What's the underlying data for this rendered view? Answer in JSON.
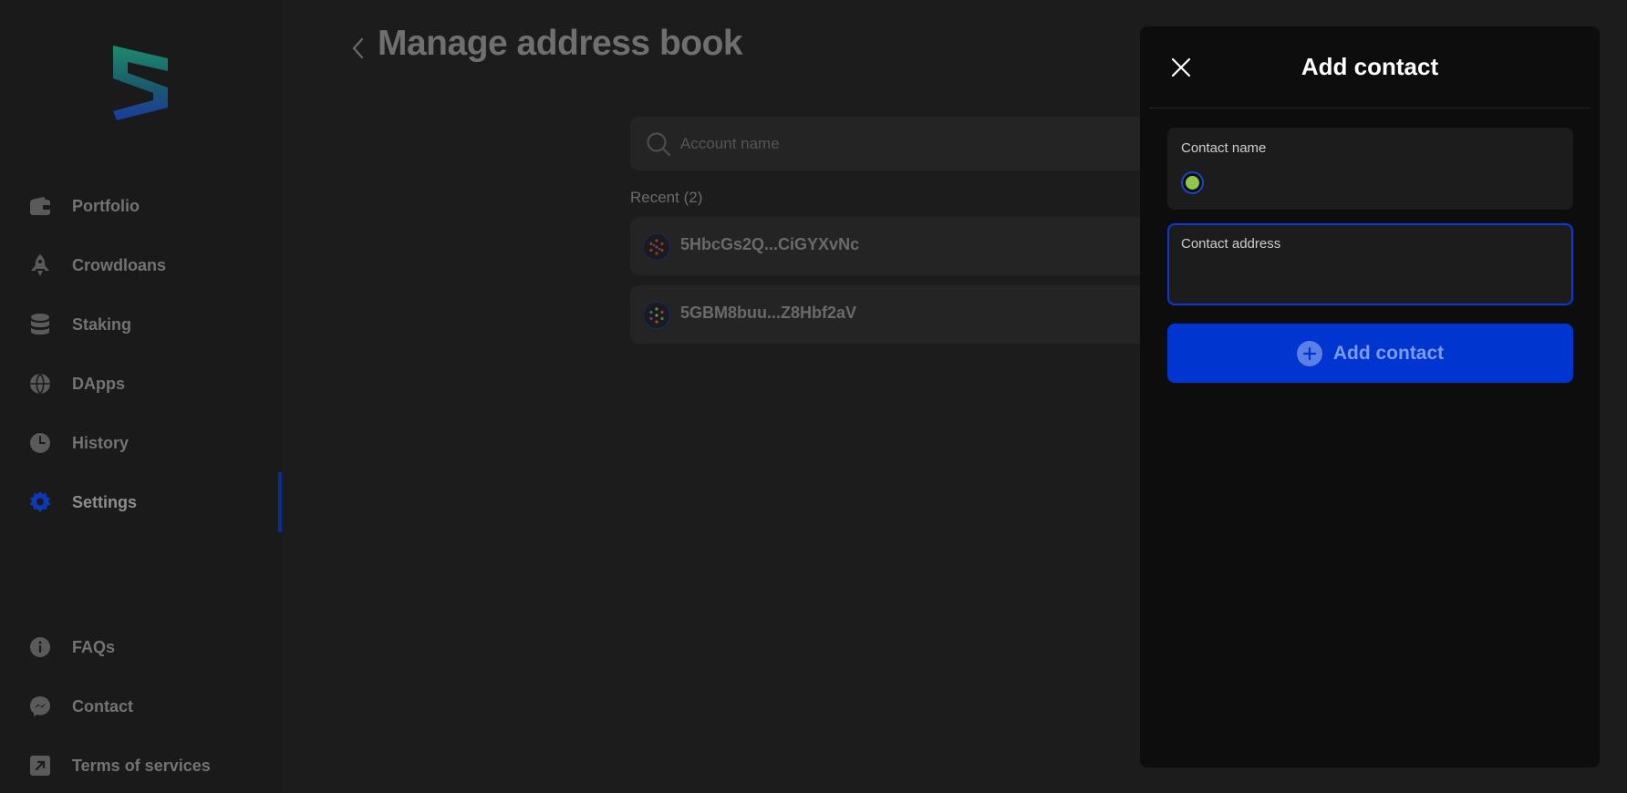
{
  "sidebar": {
    "logo": "subwallet-logo",
    "items": [
      {
        "label": "Portfolio",
        "icon": "wallet-icon"
      },
      {
        "label": "Crowdloans",
        "icon": "rocket-icon"
      },
      {
        "label": "Staking",
        "icon": "database-icon"
      },
      {
        "label": "DApps",
        "icon": "globe-icon"
      },
      {
        "label": "History",
        "icon": "clock-icon"
      },
      {
        "label": "Settings",
        "icon": "gear-icon",
        "active": true
      }
    ],
    "footer_items": [
      {
        "label": "FAQs",
        "icon": "info-icon"
      },
      {
        "label": "Contact",
        "icon": "messenger-icon"
      },
      {
        "label": "Terms of services",
        "icon": "external-link-icon"
      }
    ]
  },
  "main": {
    "title": "Manage address book",
    "search": {
      "placeholder": "Account name"
    },
    "recent_label": "Recent (2)",
    "accounts": [
      {
        "address": "5HbcGs2Q...CiGYXvNc"
      },
      {
        "address": "5GBM8buu...Z8Hbf2aV"
      }
    ]
  },
  "modal": {
    "title": "Add contact",
    "name_field": {
      "label": "Contact name",
      "value": ""
    },
    "address_field": {
      "label": "Contact address",
      "value": ""
    },
    "submit_label": "Add contact"
  },
  "colors": {
    "accent": "#0035cf",
    "sidebar_bg": "#1a1a1a",
    "modal_bg": "#0d0d0d"
  }
}
